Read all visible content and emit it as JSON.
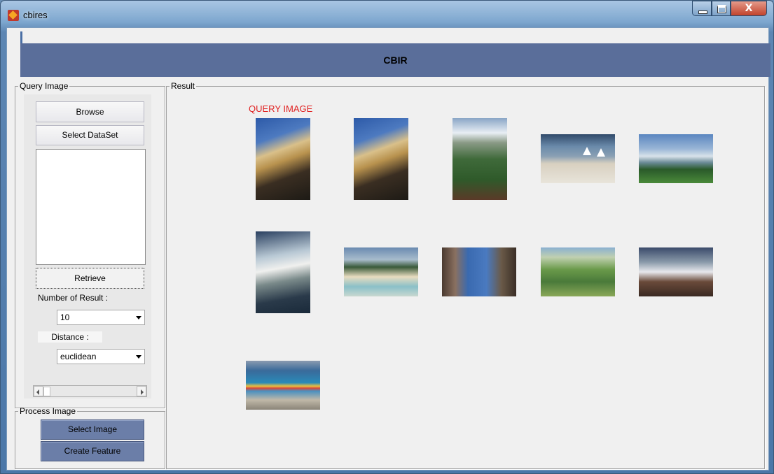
{
  "window": {
    "title": "cbires",
    "controls": {
      "minimize": "minimize",
      "maximize": "maximize",
      "close": "X"
    }
  },
  "banner": {
    "title": "CBIR"
  },
  "query_panel": {
    "legend": "Query Image",
    "browse_label": "Browse",
    "select_dataset_label": "Select DataSet",
    "retrieve_label": "Retrieve",
    "num_results_label": "Number of Result :",
    "num_results_value": "10",
    "distance_label": "Distance :",
    "distance_value": "euclidean"
  },
  "process_panel": {
    "legend": "Process Image",
    "select_image_label": "Select Image",
    "create_feature_label": "Create Feature"
  },
  "result_panel": {
    "legend": "Result",
    "query_image_label": "QUERY IMAGE",
    "results": [
      "mountain-peak",
      "mountain-peak",
      "alpine-meadow",
      "beach-sailboats",
      "alps-forest",
      "snowy-ridge",
      "beach-people",
      "rock-gorge",
      "green-valley",
      "snow-crater",
      "beach-umbrella"
    ]
  }
}
